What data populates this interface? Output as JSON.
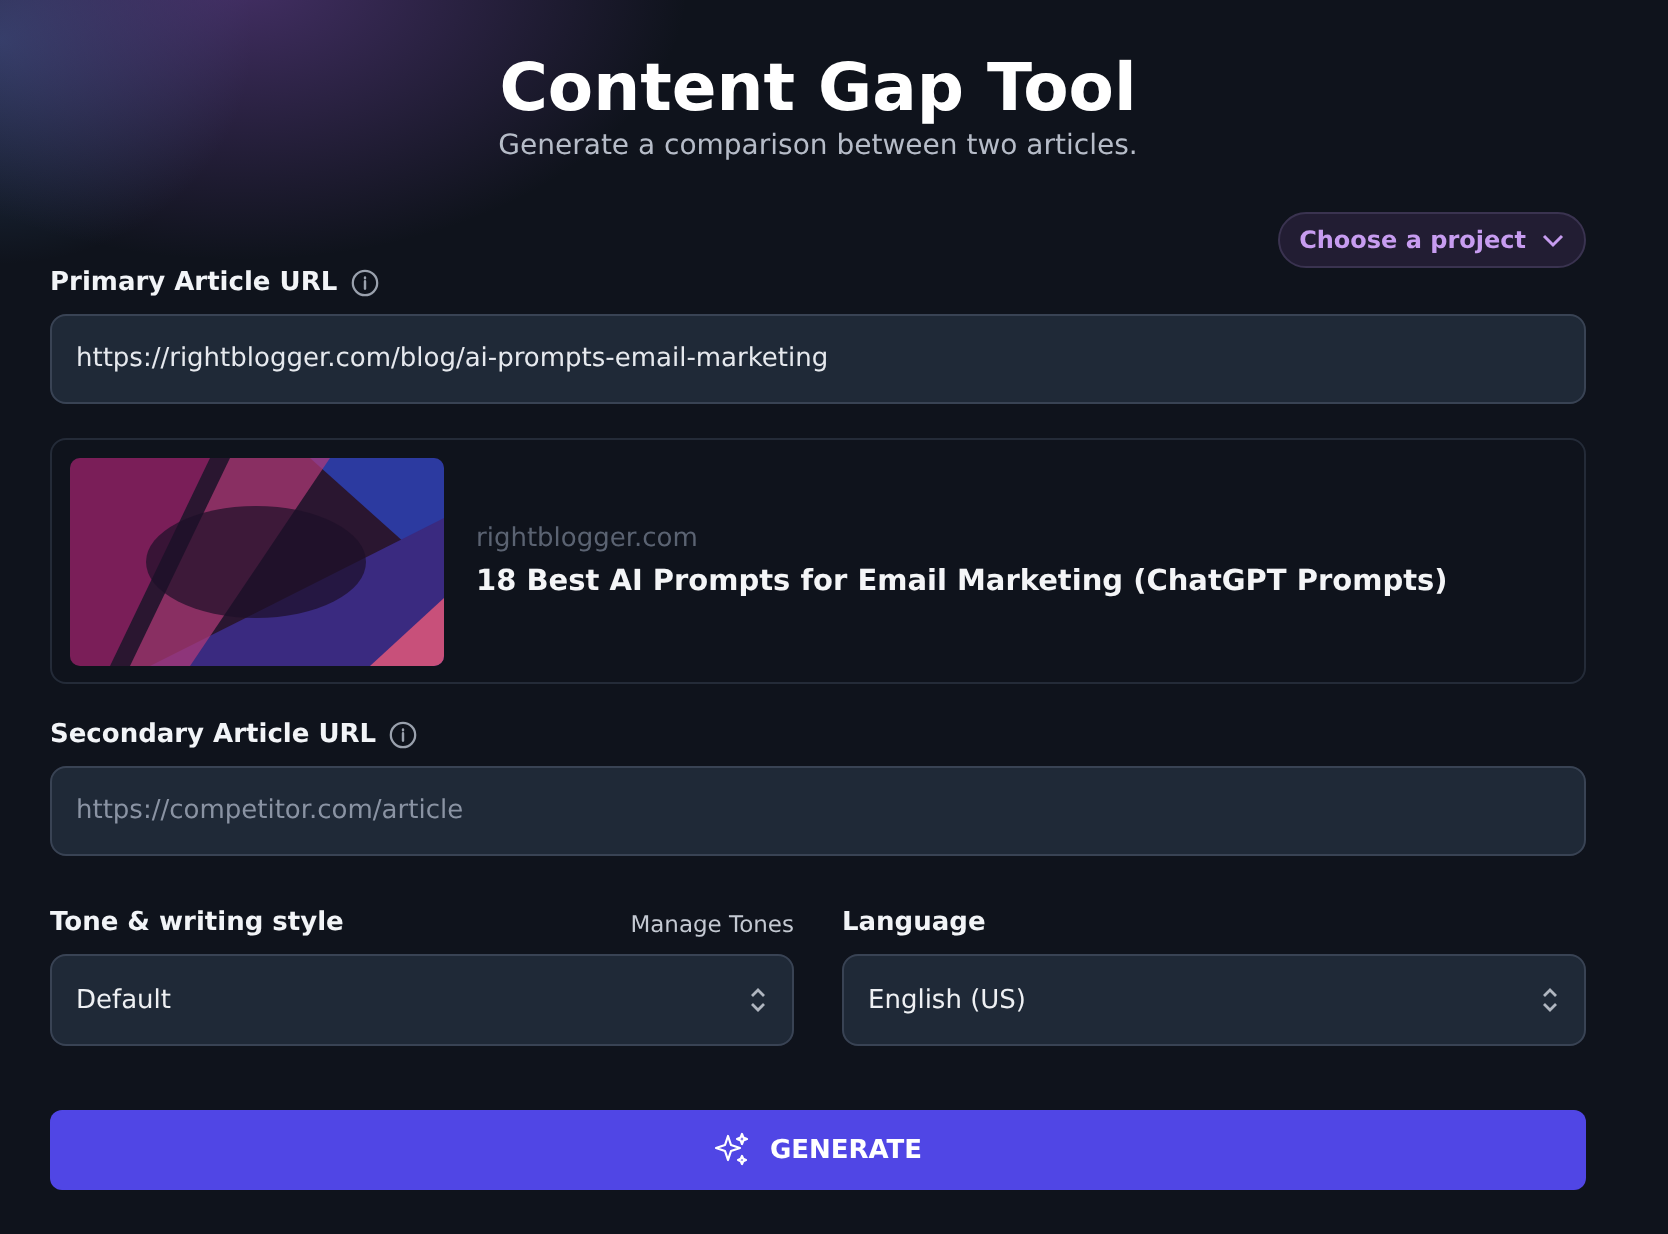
{
  "header": {
    "title": "Content Gap Tool",
    "subtitle": "Generate a comparison between two articles."
  },
  "project_button": {
    "label": "Choose a project"
  },
  "primary": {
    "label": "Primary Article URL",
    "value": "https://rightblogger.com/blog/ai-prompts-email-marketing"
  },
  "preview": {
    "domain": "rightblogger.com",
    "title": "18 Best AI Prompts for Email Marketing (ChatGPT Prompts)"
  },
  "secondary": {
    "label": "Secondary Article URL",
    "placeholder": "https://competitor.com/article"
  },
  "tone": {
    "label": "Tone & writing style",
    "link": "Manage Tones",
    "value": "Default"
  },
  "language": {
    "label": "Language",
    "value": "English (US)"
  },
  "generate_button": {
    "label": "GENERATE"
  }
}
